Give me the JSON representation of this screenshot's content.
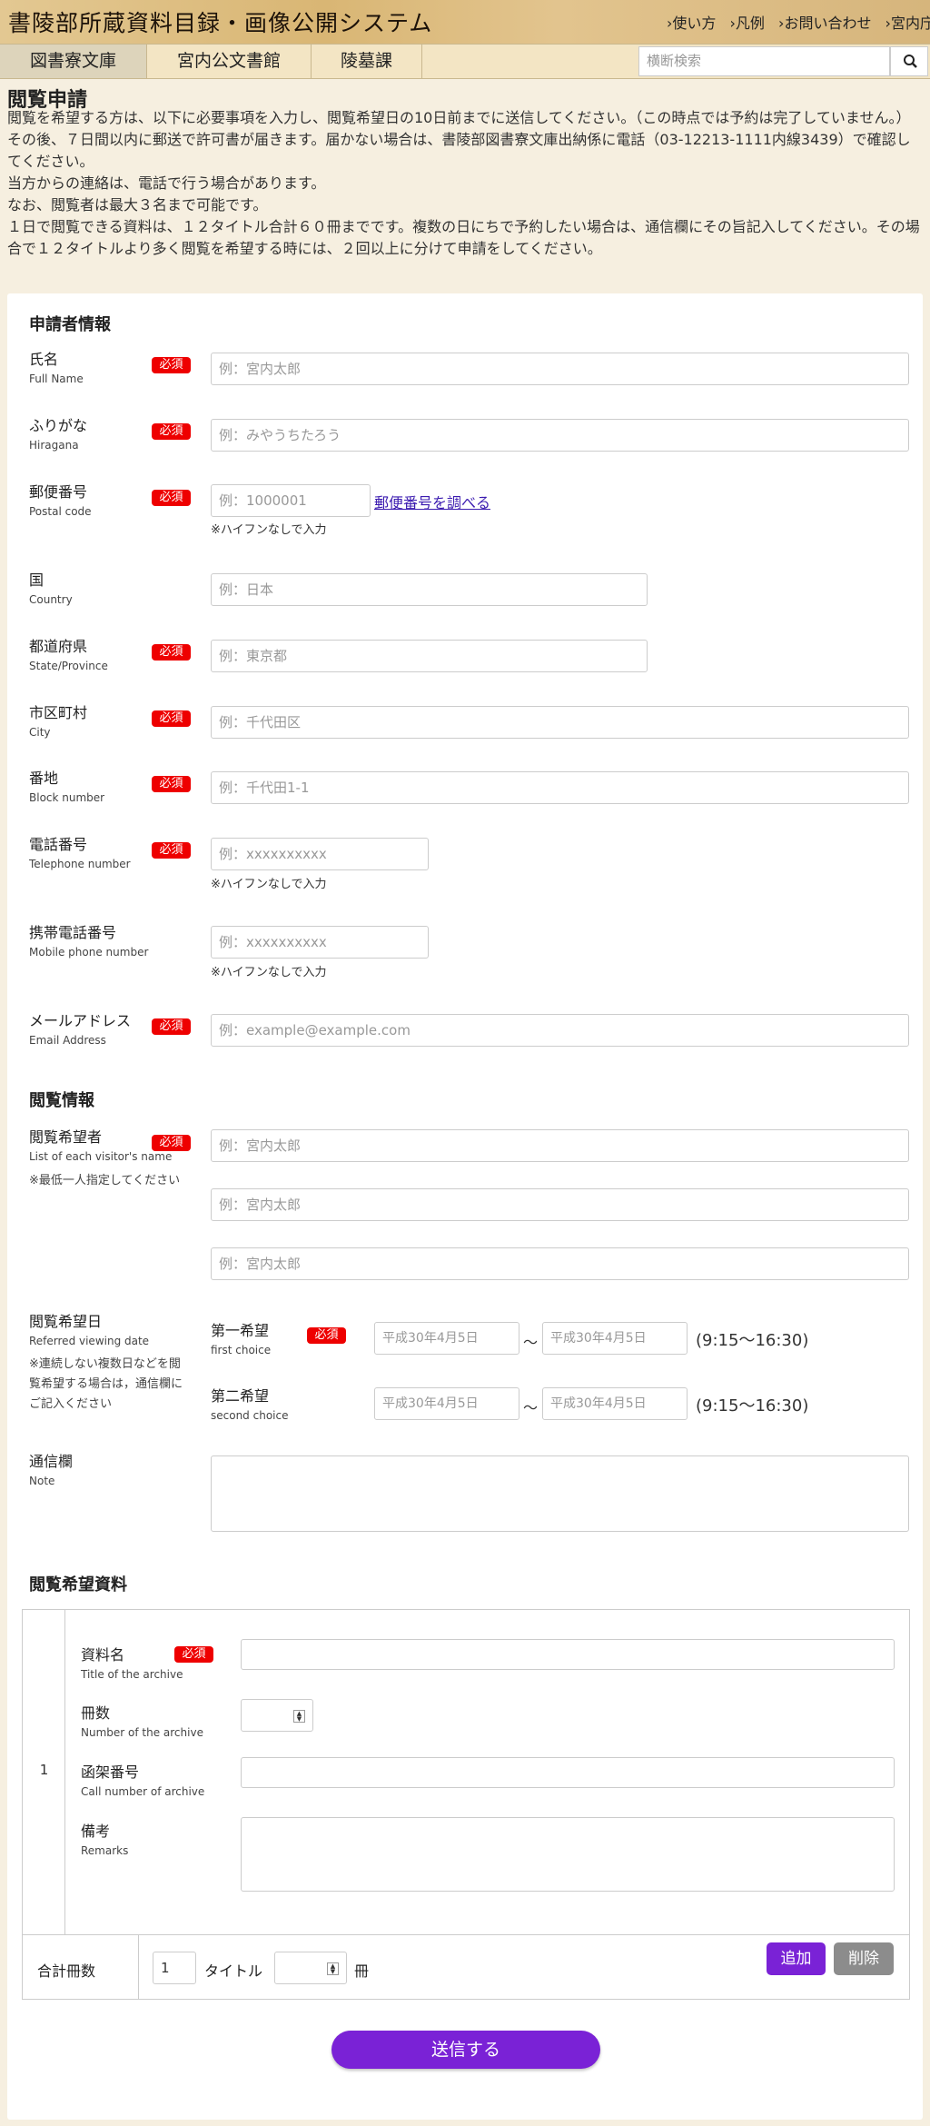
{
  "header": {
    "title": "書陵部所蔵資料目録・画像公開システム",
    "links": [
      "使い方",
      "凡例",
      "お問い合わせ",
      "宮内庁"
    ]
  },
  "nav": {
    "tabs": [
      "図書寮文庫",
      "宮内公文書館",
      "陵墓課"
    ],
    "active_tab": "図書寮文庫",
    "search_placeholder": "横断検索"
  },
  "page": {
    "title": "閲覧申請",
    "intro": [
      "閲覧を希望する方は、以下に必要事項を入力し、閲覧希望日の10日前までに送信してください。（この時点では予約は完了していません。）",
      "その後、７日間以内に郵送で許可書が届きます。届かない場合は、書陵部図書寮文庫出納係に電話（03-12213-1111内線3439）で確認してください。",
      "当方からの連絡は、電話で行う場合があります。",
      "なお、閲覧者は最大３名まで可能です。",
      "１日で閲覧できる資料は、１２タイトル合計６０冊までです。複数の日にちで予約したい場合は、通信欄にその旨記入してください。その場合で１２タイトルより多く閲覧を希望する時には、２回以上に分けて申請をしてください。"
    ]
  },
  "required_label": "必須",
  "applicant": {
    "heading": "申請者情報",
    "fields": {
      "name": {
        "label": "氏名",
        "sub": "Full Name",
        "placeholder": "例：宮内太郎"
      },
      "kana": {
        "label": "ふりがな",
        "sub": "Hiragana",
        "placeholder": "例：みやうちたろう"
      },
      "postal": {
        "label": "郵便番号",
        "sub": "Postal code",
        "placeholder": "例：1000001",
        "note": "※ハイフンなしで入力",
        "lookup_link": "郵便番号を調べる"
      },
      "country": {
        "label": "国",
        "sub": "Country",
        "placeholder": "例：日本"
      },
      "state": {
        "label": "都道府県",
        "sub": "State/Province",
        "placeholder": "例：東京都"
      },
      "city": {
        "label": "市区町村",
        "sub": "City",
        "placeholder": "例：千代田区"
      },
      "block": {
        "label": "番地",
        "sub": "Block number",
        "placeholder": "例：千代田1-1"
      },
      "phone": {
        "label": "電話番号",
        "sub": "Telephone number",
        "placeholder": "例：xxxxxxxxxx",
        "note": "※ハイフンなしで入力"
      },
      "mobile": {
        "label": "携帯電話番号",
        "sub": "Mobile phone number",
        "placeholder": "例：xxxxxxxxxx",
        "note": "※ハイフンなしで入力"
      },
      "email": {
        "label": "メールアドレス",
        "sub": "Email Address",
        "placeholder": "例：example@example.com"
      }
    }
  },
  "viewing": {
    "heading": "閲覧情報",
    "visitors": {
      "label": "閲覧希望者",
      "sub": "List of each visitor's name",
      "note": "※最低一人指定してください",
      "placeholder": "例：宮内太郎"
    },
    "date": {
      "label": "閲覧希望日",
      "sub": "Referred viewing date",
      "note": [
        "※連続しない複数日などを閲",
        "覧希望する場合は，通信欄に",
        "ご記入ください"
      ],
      "first": {
        "label": "第一希望",
        "sub": "first choice"
      },
      "second": {
        "label": "第二希望",
        "sub": "second choice"
      },
      "date_placeholder": "平成30年4月5日",
      "tilde": "〜",
      "hours": "(9:15〜16:30)"
    },
    "note_field": {
      "label": "通信欄",
      "sub": "Note"
    }
  },
  "materials": {
    "heading": "閲覧希望資料",
    "row_number": "1",
    "title": {
      "label": "資料名",
      "sub": "Title of the archive"
    },
    "count": {
      "label": "冊数",
      "sub": "Number of the archive"
    },
    "call_number": {
      "label": "函架番号",
      "sub": "Call number of archive"
    },
    "remarks": {
      "label": "備考",
      "sub": "Remarks"
    },
    "total_label": "合計冊数",
    "total_titles": "1",
    "titles_unit": "タイトル",
    "volumes_unit": "冊",
    "add_button": "追加",
    "delete_button": "削除"
  },
  "submit_button": "送信する",
  "colors": {
    "accent": "#7a22d6",
    "required": "#ee0000",
    "background": "#f6efe0",
    "header": "#d9b674"
  }
}
